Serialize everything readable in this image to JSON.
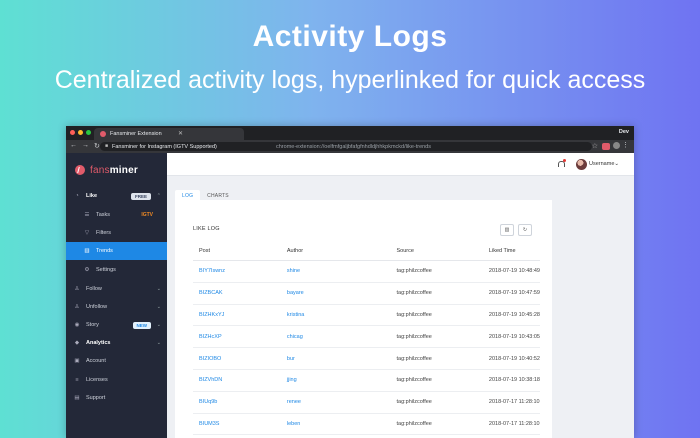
{
  "hero": {
    "title": "Activity Logs",
    "subtitle": "Centralized activity logs, hyperlinked for quick access"
  },
  "browser": {
    "tab_title": "Fansminer Extension",
    "profile": "Dev",
    "site_label": "Fansminer for Instagram (IGTV Supported)",
    "url": "chrome-extension://oelfmfgaljbfafgfnhdldjhhkpkmckd/like-trends"
  },
  "sidebar": {
    "logo_prefix": "fans",
    "logo_suffix": "miner",
    "items": [
      {
        "label": "Like",
        "badge": "FREE"
      },
      {
        "label": "Tasks",
        "tag": "IGTV"
      },
      {
        "label": "Filters"
      },
      {
        "label": "Trends"
      },
      {
        "label": "Settings"
      },
      {
        "label": "Follow"
      },
      {
        "label": "Unfollow"
      },
      {
        "label": "Story",
        "badge": "NEW"
      },
      {
        "label": "Analytics"
      },
      {
        "label": "Account"
      },
      {
        "label": "Licenses"
      },
      {
        "label": "Support"
      }
    ]
  },
  "topbar": {
    "username": "Username"
  },
  "tabs": [
    "LOG",
    "CHARTS"
  ],
  "card": {
    "title": "LIKE LOG",
    "columns": [
      "Post",
      "Author",
      "Source",
      "Liked Time"
    ],
    "rows": [
      [
        "BIY7Iswnz",
        "shine",
        "tag:philzcoffee",
        "2018-07-19 10:48:49"
      ],
      [
        "BIZBCAK",
        "bayare",
        "tag:philzcoffee",
        "2018-07-19 10:47:59"
      ],
      [
        "BIZHKxYJ",
        "kristina",
        "tag:philzcoffee",
        "2018-07-19 10:45:28"
      ],
      [
        "BIZHcXP",
        "chicag",
        "tag:philzcoffee",
        "2018-07-19 10:43:05"
      ],
      [
        "BIZIOBO",
        "bur",
        "tag:philzcoffee",
        "2018-07-19 10:40:52"
      ],
      [
        "BIZVhDN",
        "jjing",
        "tag:philzcoffee",
        "2018-07-19 10:38:18"
      ],
      [
        "BIUq9b",
        "renee",
        "tag:philzcoffee",
        "2018-07-17 11:28:10"
      ],
      [
        "BIUM3S",
        "leben",
        "tag:philzcoffee",
        "2018-07-17 11:28:10"
      ]
    ]
  },
  "colors": {
    "sidebar_bg": "#232838",
    "accent": "#1e88e5",
    "brand": "#e05b6a"
  }
}
